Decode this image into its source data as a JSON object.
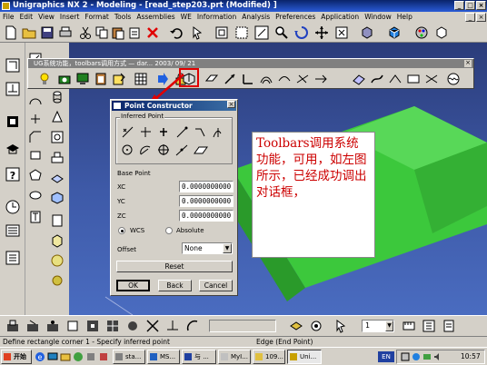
{
  "window": {
    "title": "Unigraphics NX 2 - Modeling - [read_step203.prt (Modified) ]"
  },
  "menu": [
    "File",
    "Edit",
    "View",
    "Insert",
    "Format",
    "Tools",
    "Assemblies",
    "WE",
    "Information",
    "Analysis",
    "Preferences",
    "Application",
    "Window",
    "Help"
  ],
  "floating_toolbar": {
    "title": "UG系统功能，toolbars调用方式 — dar... 2003/ 09/ 21"
  },
  "dialog": {
    "title": "Point Constructor",
    "inferred_point_label": "Inferred Point",
    "base_point_label": "Base Point",
    "xc_label": "XC",
    "yc_label": "YC",
    "zc_label": "ZC",
    "xc_value": "0.0000000000",
    "yc_value": "0.0000000000",
    "zc_value": "0.0000000000",
    "wcs_label": "WCS",
    "absolute_label": "Absolute",
    "offset_label": "Offset",
    "offset_value": "None",
    "reset_label": "Reset",
    "ok_label": "OK",
    "back_label": "Back",
    "cancel_label": "Cancel"
  },
  "note": {
    "text": "Toolbars调用系统功能，可用，如左图所示，已经成功调出对话框，"
  },
  "bottom_toolbar": {
    "layer_value": "1"
  },
  "status": {
    "left": "Define rectangle corner 1 - Specify inferred point",
    "right": "Edge (End Point)"
  },
  "taskbar": {
    "start_label": "开始",
    "tasks": [
      "sta...",
      "MS...",
      "与 ...",
      "MyI...",
      "109...",
      "Uni..."
    ],
    "clock": "10:57",
    "lang": "EN"
  },
  "colors": {
    "title_blue": "#0a246a",
    "canvas_blue": "#3e5aa8",
    "highlight_red": "#e00000",
    "model_green": "#3cc83c",
    "note_red": "#cc0000"
  }
}
